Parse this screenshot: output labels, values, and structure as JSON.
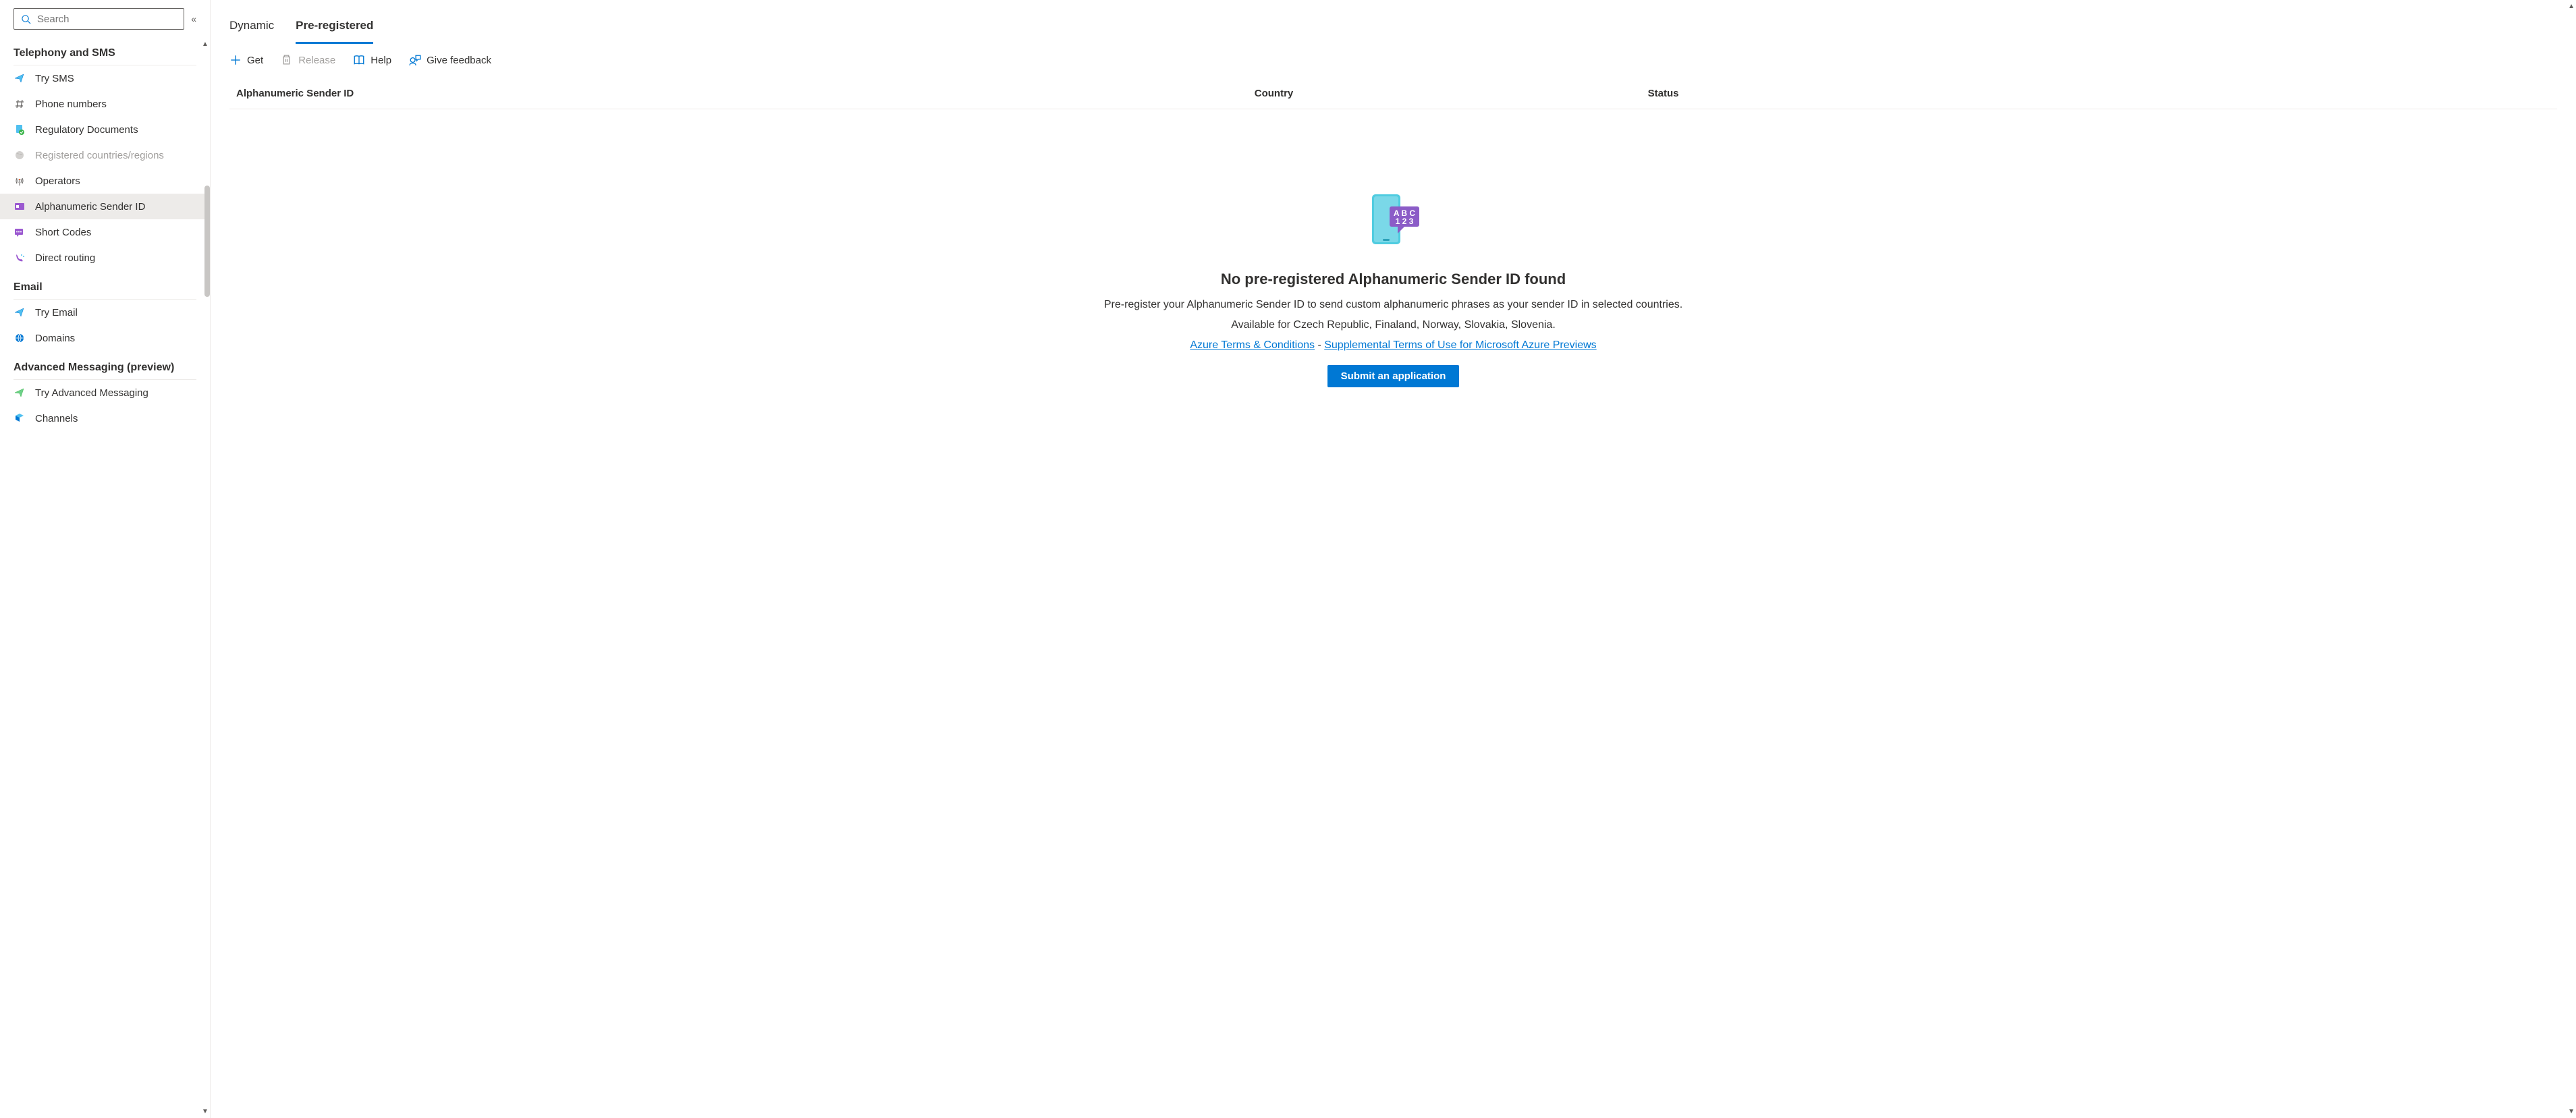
{
  "search": {
    "placeholder": "Search"
  },
  "sections": {
    "telephony": {
      "title": "Telephony and SMS",
      "items": [
        {
          "label": "Try SMS"
        },
        {
          "label": "Phone numbers"
        },
        {
          "label": "Regulatory Documents"
        },
        {
          "label": "Registered countries/regions"
        },
        {
          "label": "Operators"
        },
        {
          "label": "Alphanumeric Sender ID"
        },
        {
          "label": "Short Codes"
        },
        {
          "label": "Direct routing"
        }
      ]
    },
    "email": {
      "title": "Email",
      "items": [
        {
          "label": "Try Email"
        },
        {
          "label": "Domains"
        }
      ]
    },
    "adv": {
      "title": "Advanced Messaging (preview)",
      "items": [
        {
          "label": "Try Advanced Messaging"
        },
        {
          "label": "Channels"
        }
      ]
    }
  },
  "tabs": {
    "dynamic": "Dynamic",
    "preregistered": "Pre-registered"
  },
  "toolbar": {
    "get": "Get",
    "release": "Release",
    "help": "Help",
    "feedback": "Give feedback"
  },
  "table": {
    "col1": "Alphanumeric Sender ID",
    "col2": "Country",
    "col3": "Status"
  },
  "empty": {
    "title": "No pre-registered Alphanumeric Sender ID found",
    "desc1": "Pre-register your Alphanumeric Sender ID to send custom alphanumeric phrases as your sender ID in selected countries.",
    "desc2": "Available for Czech Republic, Finaland, Norway, Slovakia, Slovenia.",
    "link1": "Azure Terms & Conditions",
    "sep": " - ",
    "link2": "Supplemental Terms of Use for Microsoft Azure Previews",
    "button": "Submit an application"
  }
}
